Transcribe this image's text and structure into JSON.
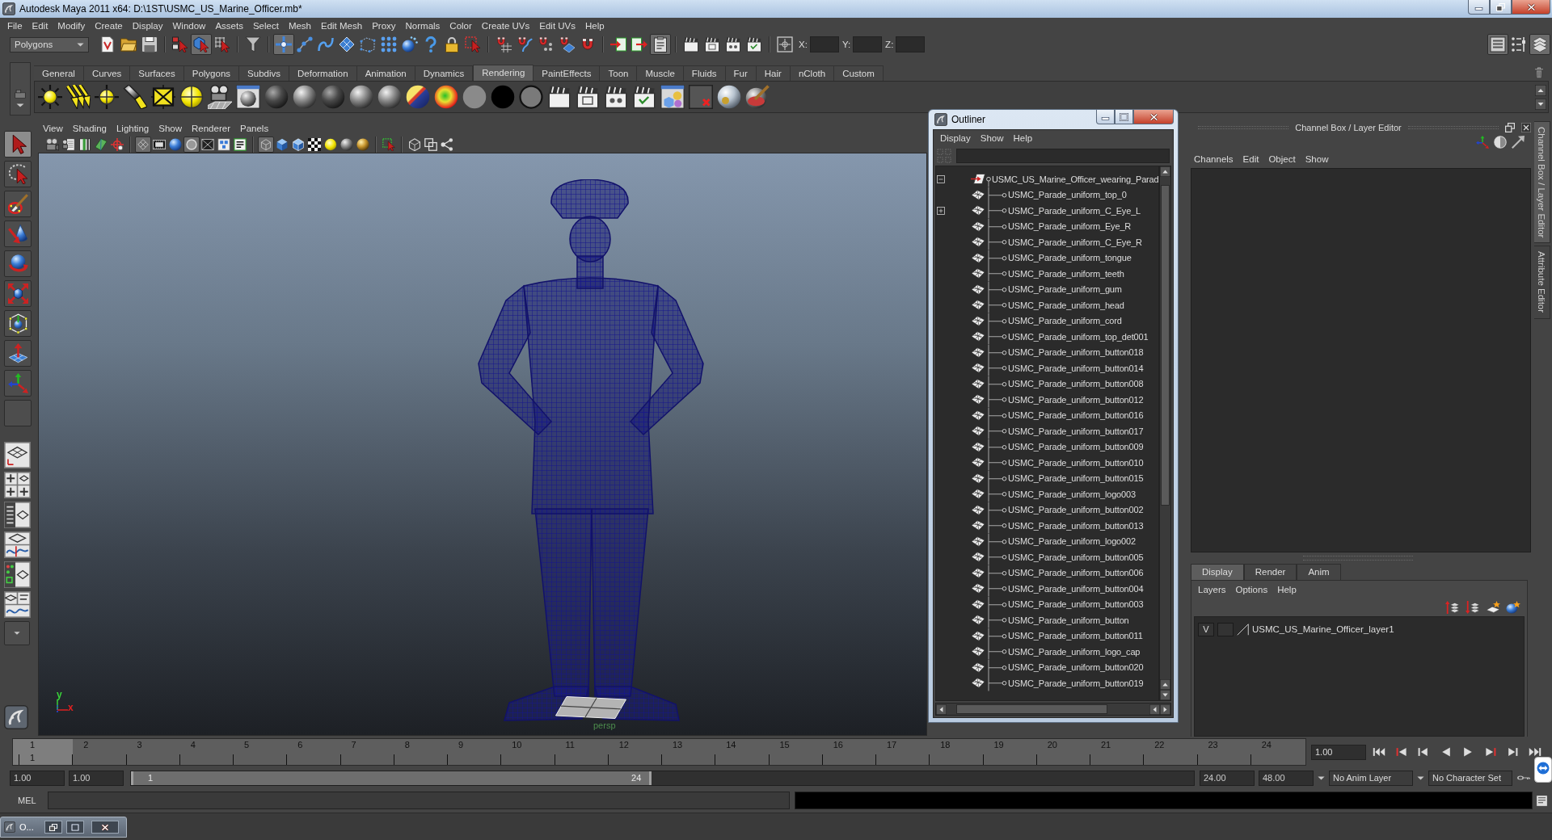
{
  "window": {
    "title": "Autodesk Maya 2011 x64: D:\\1ST\\USMC_US_Marine_Officer.mb*"
  },
  "menu_bar": [
    "File",
    "Edit",
    "Modify",
    "Create",
    "Display",
    "Window",
    "Assets",
    "Select",
    "Mesh",
    "Edit Mesh",
    "Proxy",
    "Normals",
    "Color",
    "Create UVs",
    "Edit UVs",
    "Help"
  ],
  "status_line": {
    "menu_set": "Polygons",
    "button_groups": [
      [
        {
          "kind": "new",
          "on": false
        },
        {
          "kind": "open",
          "on": false
        },
        {
          "kind": "save",
          "on": false
        }
      ],
      [
        {
          "kind": "hierarchy",
          "on": false
        },
        {
          "kind": "objects",
          "on": true
        },
        {
          "kind": "components",
          "on": false
        }
      ],
      [
        {
          "kind": "filter",
          "on": false
        }
      ],
      [
        {
          "kind": "handles",
          "on": true
        },
        {
          "kind": "joints",
          "on": false
        },
        {
          "kind": "curves",
          "on": false
        },
        {
          "kind": "surfaces",
          "on": false
        },
        {
          "kind": "deformations",
          "on": false
        },
        {
          "kind": "dynamics",
          "on": false
        },
        {
          "kind": "rendering",
          "on": false
        },
        {
          "kind": "misc",
          "on": false
        },
        {
          "kind": "lock",
          "on": false
        },
        {
          "kind": "marquee",
          "on": false
        }
      ],
      [
        {
          "kind": "snapgrid",
          "on": false
        },
        {
          "kind": "snapcurve",
          "on": false
        },
        {
          "kind": "snappoint",
          "on": false
        },
        {
          "kind": "snapplane",
          "on": false
        },
        {
          "kind": "snaplive",
          "on": false
        }
      ],
      [
        {
          "kind": "inputs",
          "on": false
        },
        {
          "kind": "outputs",
          "on": false
        },
        {
          "kind": "history",
          "on": true
        }
      ],
      [
        {
          "kind": "render",
          "on": false
        },
        {
          "kind": "ipr",
          "on": false
        },
        {
          "kind": "settings",
          "on": false
        },
        {
          "kind": "hypershade",
          "on": false
        }
      ]
    ],
    "coordinates": [
      {
        "label": "X:"
      },
      {
        "label": "Y:"
      },
      {
        "label": "Z:"
      }
    ],
    "panel_buttons": [
      {
        "kind": "attributes",
        "on": true
      },
      {
        "kind": "toolsettings",
        "on": false
      },
      {
        "kind": "channelbox",
        "on": true
      }
    ]
  },
  "shelf": {
    "tabs": [
      {
        "label": "General",
        "selected": false
      },
      {
        "label": "Curves",
        "selected": false
      },
      {
        "label": "Surfaces",
        "selected": false
      },
      {
        "label": "Polygons",
        "selected": false
      },
      {
        "label": "Subdivs",
        "selected": false
      },
      {
        "label": "Deformation",
        "selected": false
      },
      {
        "label": "Animation",
        "selected": false
      },
      {
        "label": "Dynamics",
        "selected": false
      },
      {
        "label": "Rendering",
        "selected": true
      },
      {
        "label": "PaintEffects",
        "selected": false
      },
      {
        "label": "Toon",
        "selected": false
      },
      {
        "label": "Muscle",
        "selected": false
      },
      {
        "label": "Fluids",
        "selected": false
      },
      {
        "label": "Fur",
        "selected": false
      },
      {
        "label": "Hair",
        "selected": false
      },
      {
        "label": "nCloth",
        "selected": false
      },
      {
        "label": "Custom",
        "selected": false
      }
    ]
  },
  "toolbox": [
    {
      "kind": "select",
      "selected": true
    },
    {
      "kind": "lasso",
      "selected": false
    },
    {
      "kind": "paint",
      "selected": false
    },
    {
      "kind": "move",
      "selected": false
    },
    {
      "kind": "rotate",
      "selected": false
    },
    {
      "kind": "scale",
      "selected": false
    },
    {
      "kind": "manip",
      "selected": false
    },
    {
      "kind": "softmod",
      "selected": false
    },
    {
      "kind": "showmanip",
      "selected": false
    },
    {
      "kind": "empty",
      "selected": false
    }
  ],
  "viewport": {
    "menus": [
      "View",
      "Shading",
      "Lighting",
      "Show",
      "Renderer",
      "Panels"
    ],
    "button_groups": [
      [
        {
          "kind": "camera",
          "on": false
        },
        {
          "kind": "camattr",
          "on": false
        },
        {
          "kind": "bookmark",
          "on": false
        },
        {
          "kind": "imageplane",
          "on": false
        },
        {
          "kind": "pan2d",
          "on": false
        }
      ],
      [
        {
          "kind": "grid",
          "on": true
        },
        {
          "kind": "filmgate",
          "on": false
        },
        {
          "kind": "resolution",
          "on": false
        },
        {
          "kind": "gatemask",
          "on": true
        },
        {
          "kind": "fieldchart",
          "on": false
        },
        {
          "kind": "safeaction",
          "on": false
        },
        {
          "kind": "safetitle",
          "on": false
        }
      ],
      [
        {
          "kind": "wireframe",
          "on": true
        },
        {
          "kind": "smooth",
          "on": false
        },
        {
          "kind": "wireonshaded",
          "on": false
        },
        {
          "kind": "textured",
          "on": false
        },
        {
          "kind": "lights",
          "on": false
        },
        {
          "kind": "shadows",
          "on": false
        },
        {
          "kind": "hq",
          "on": false
        }
      ],
      [
        {
          "kind": "isolate",
          "on": false
        }
      ],
      [
        {
          "kind": "xray",
          "on": false
        },
        {
          "kind": "xrayjoints",
          "on": false
        },
        {
          "kind": "xjoints",
          "on": false
        }
      ]
    ],
    "camera_label": "persp",
    "axis_labels": [
      "y",
      "x"
    ]
  },
  "outliner": {
    "title": "Outliner",
    "menus": [
      "Display",
      "Show",
      "Help"
    ],
    "root": {
      "name": "USMC_US_Marine_Officer_wearing_Parad",
      "expanded": true,
      "children": [
        {
          "name": "USMC_Parade_uniform_top_0",
          "collapsed": false
        },
        {
          "name": "USMC_Parade_uniform_C_Eye_L",
          "collapsed": true
        },
        {
          "name": "USMC_Parade_uniform_Eye_R",
          "collapsed": false
        },
        {
          "name": "USMC_Parade_uniform_C_Eye_R",
          "collapsed": false
        },
        {
          "name": "USMC_Parade_uniform_tongue",
          "collapsed": false
        },
        {
          "name": "USMC_Parade_uniform_teeth",
          "collapsed": false
        },
        {
          "name": "USMC_Parade_uniform_gum",
          "collapsed": false
        },
        {
          "name": "USMC_Parade_uniform_head",
          "collapsed": false
        },
        {
          "name": "USMC_Parade_uniform_cord",
          "collapsed": false
        },
        {
          "name": "USMC_Parade_uniform_top_det001",
          "collapsed": false
        },
        {
          "name": "USMC_Parade_uniform_button018",
          "collapsed": false
        },
        {
          "name": "USMC_Parade_uniform_button014",
          "collapsed": false
        },
        {
          "name": "USMC_Parade_uniform_button008",
          "collapsed": false
        },
        {
          "name": "USMC_Parade_uniform_button012",
          "collapsed": false
        },
        {
          "name": "USMC_Parade_uniform_button016",
          "collapsed": false
        },
        {
          "name": "USMC_Parade_uniform_button017",
          "collapsed": false
        },
        {
          "name": "USMC_Parade_uniform_button009",
          "collapsed": false
        },
        {
          "name": "USMC_Parade_uniform_button010",
          "collapsed": false
        },
        {
          "name": "USMC_Parade_uniform_button015",
          "collapsed": false
        },
        {
          "name": "USMC_Parade_uniform_logo003",
          "collapsed": false
        },
        {
          "name": "USMC_Parade_uniform_button002",
          "collapsed": false
        },
        {
          "name": "USMC_Parade_uniform_button013",
          "collapsed": false
        },
        {
          "name": "USMC_Parade_uniform_logo002",
          "collapsed": false
        },
        {
          "name": "USMC_Parade_uniform_button005",
          "collapsed": false
        },
        {
          "name": "USMC_Parade_uniform_button006",
          "collapsed": false
        },
        {
          "name": "USMC_Parade_uniform_button004",
          "collapsed": false
        },
        {
          "name": "USMC_Parade_uniform_button003",
          "collapsed": false
        },
        {
          "name": "USMC_Parade_uniform_button",
          "collapsed": false
        },
        {
          "name": "USMC_Parade_uniform_button011",
          "collapsed": false
        },
        {
          "name": "USMC_Parade_uniform_logo_cap",
          "collapsed": false
        },
        {
          "name": "USMC_Parade_uniform_button020",
          "collapsed": false
        },
        {
          "name": "USMC_Parade_uniform_button019",
          "collapsed": false
        }
      ]
    }
  },
  "channel_box": {
    "title": "Channel Box / Layer Editor",
    "menus": [
      "Channels",
      "Edit",
      "Object",
      "Show"
    ],
    "layer_tabs": [
      {
        "label": "Display",
        "selected": true
      },
      {
        "label": "Render",
        "selected": false
      },
      {
        "label": "Anim",
        "selected": false
      }
    ],
    "layer_menus": [
      "Layers",
      "Options",
      "Help"
    ],
    "layers": [
      {
        "visibility": "V",
        "name": "USMC_US_Marine_Officer_layer1"
      }
    ]
  },
  "side_tabs": [
    {
      "label": "Channel Box / Layer Editor",
      "selected": true
    },
    {
      "label": "Attribute Editor",
      "selected": false
    }
  ],
  "time_slider": {
    "frames": [
      {
        "label": "1",
        "selected": true
      },
      {
        "label": "2",
        "selected": false
      },
      {
        "label": "3",
        "selected": false
      },
      {
        "label": "4",
        "selected": false
      },
      {
        "label": "5",
        "selected": false
      },
      {
        "label": "6",
        "selected": false
      },
      {
        "label": "7",
        "selected": false
      },
      {
        "label": "8",
        "selected": false
      },
      {
        "label": "9",
        "selected": false
      },
      {
        "label": "10",
        "selected": false
      },
      {
        "label": "11",
        "selected": false
      },
      {
        "label": "12",
        "selected": false
      },
      {
        "label": "13",
        "selected": false
      },
      {
        "label": "14",
        "selected": false
      },
      {
        "label": "15",
        "selected": false
      },
      {
        "label": "16",
        "selected": false
      },
      {
        "label": "17",
        "selected": false
      },
      {
        "label": "18",
        "selected": false
      },
      {
        "label": "19",
        "selected": false
      },
      {
        "label": "20",
        "selected": false
      },
      {
        "label": "21",
        "selected": false
      },
      {
        "label": "22",
        "selected": false
      },
      {
        "label": "23",
        "selected": false
      },
      {
        "label": "24",
        "selected": false
      }
    ],
    "current_frame": "1",
    "current_time": "1.00"
  },
  "range_slider": {
    "start_time": "1.00",
    "range_start": "1.00",
    "bar_start": "1",
    "bar_end": "24",
    "level": 0.49,
    "range_end": "24.00",
    "end_time": "48.00",
    "anim_layer": "No Anim Layer",
    "character_set": "No Character Set"
  },
  "command_line": {
    "label": "MEL"
  },
  "minimized_window": {
    "title": "O..."
  }
}
